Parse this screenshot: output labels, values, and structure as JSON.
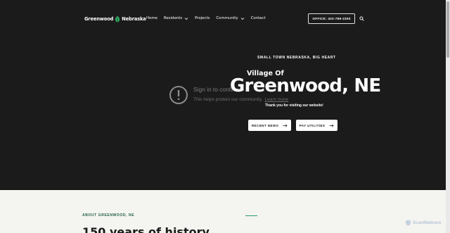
{
  "header": {
    "logo_left": "Greenwood",
    "logo_right": "Nebraska",
    "nav": [
      {
        "label": "Home"
      },
      {
        "label": "Residents"
      },
      {
        "label": "Projects"
      },
      {
        "label": "Community"
      },
      {
        "label": "Contact"
      }
    ],
    "office_button": "OFFICE: 402-789-2300"
  },
  "hero": {
    "eyebrow": "SMALL TOWN NEBRASKA, BIG HEART",
    "pre_title": "Village Of",
    "title": "Greenwood, NE",
    "subtitle": "Thank you for visiting our website!",
    "buttons": [
      {
        "label": "RECENT NEWS"
      },
      {
        "label": "PAY UTILITIES"
      }
    ]
  },
  "overlay": {
    "title": "Sign in to confirm",
    "subtitle": "This helps protect our community.",
    "link": "Learn more"
  },
  "about": {
    "label": "ABOUT GREENWOOD, NE",
    "heading": "150 years of history"
  },
  "badge": "ScanMalware",
  "colors": {
    "hero_bg": "#1b1b1b",
    "accent_green": "#2a9c6a",
    "label_green": "#1f5d45",
    "section_bg": "#f4f4f1"
  }
}
